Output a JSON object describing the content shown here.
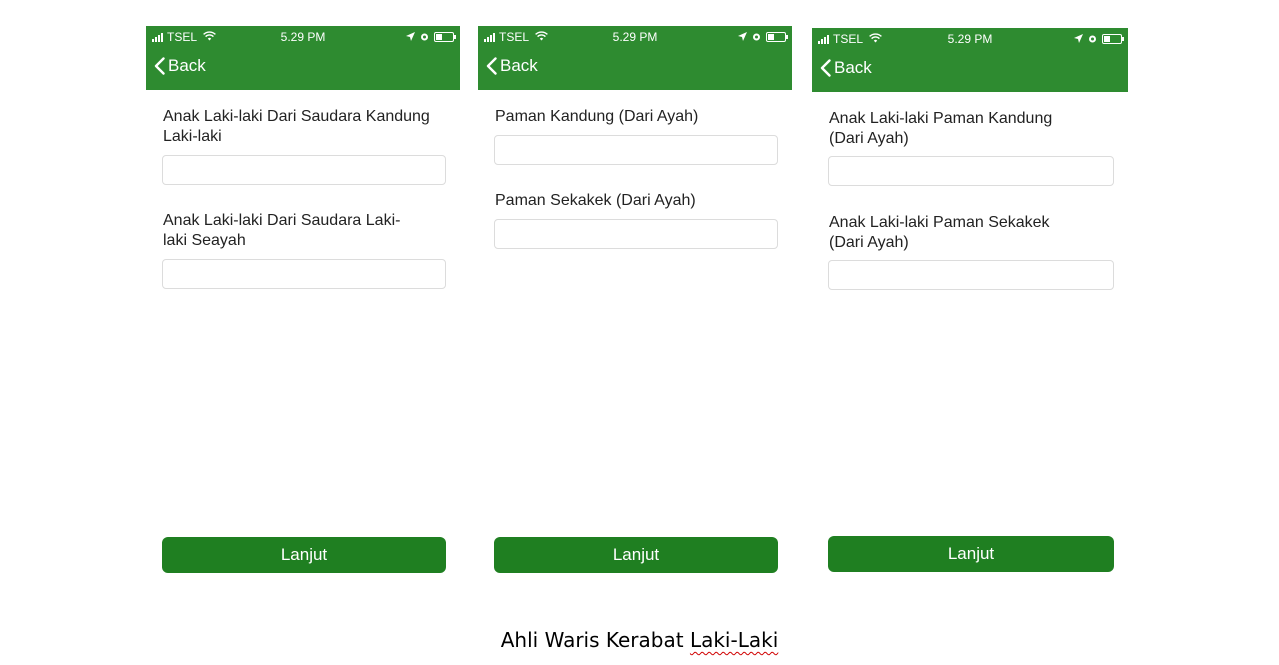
{
  "status_bar": {
    "carrier": "TSEL",
    "time": "5.29 PM"
  },
  "nav": {
    "back_label": "Back"
  },
  "screens": [
    {
      "fields": [
        {
          "label": "Anak Laki-laki Dari Saudara Kandung Laki-laki",
          "value": ""
        },
        {
          "label": "Anak Laki-laki Dari Saudara Laki-laki Seayah",
          "value": ""
        }
      ],
      "button_label": "Lanjut"
    },
    {
      "fields": [
        {
          "label": "Paman Kandung (Dari Ayah)",
          "value": ""
        },
        {
          "label": "Paman Sekakek (Dari Ayah)",
          "value": ""
        }
      ],
      "button_label": "Lanjut"
    },
    {
      "fields": [
        {
          "label": "Anak Laki-laki Paman Kandung (Dari Ayah)",
          "value": ""
        },
        {
          "label": "Anak Laki-laki Paman Sekakek (Dari Ayah)",
          "value": ""
        }
      ],
      "button_label": "Lanjut"
    }
  ],
  "caption": {
    "prefix": "Ahli Waris Kerabat ",
    "misspelled": "Laki-Laki"
  },
  "colors": {
    "appbar": "#2e8b30",
    "button": "#1f7f21",
    "spellcheck": "#d00000"
  }
}
